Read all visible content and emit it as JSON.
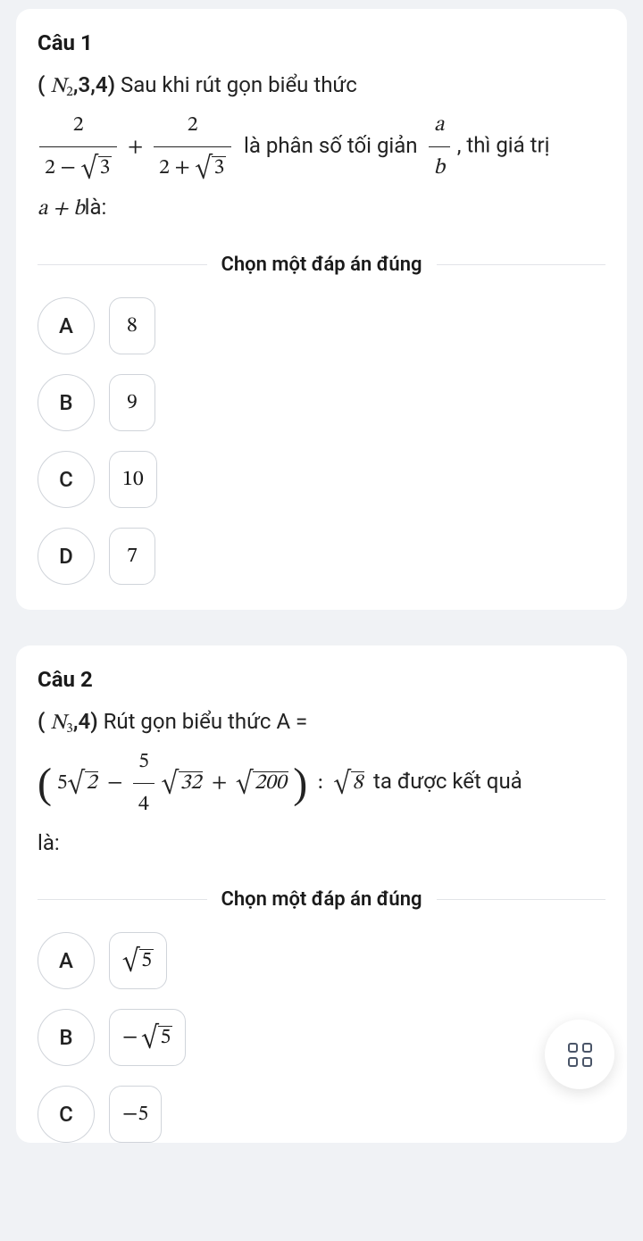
{
  "q1": {
    "title": "Câu 1",
    "tag_prefix": "N",
    "tag_sub": "2",
    "tag_suffix": ",3,4",
    "text_before_expr": "Sau khi rút gọn biểu thức",
    "frac1_num": "2",
    "frac1_den_left": "2 −",
    "frac1_den_rad": "3",
    "plus": "+",
    "frac2_num": "2",
    "frac2_den_left": "2 +",
    "frac2_den_rad": "3",
    "text_mid": "là phân số tối giản",
    "ab_num": "a",
    "ab_den": "b",
    "text_after": ", thì giá trị",
    "line2_left": "a + b",
    "line2_right": "là:",
    "instruction": "Chọn một đáp án đúng",
    "options": [
      {
        "letter": "A",
        "value": "8"
      },
      {
        "letter": "B",
        "value": "9"
      },
      {
        "letter": "C",
        "value": "10"
      },
      {
        "letter": "D",
        "value": "7"
      }
    ]
  },
  "q2": {
    "title": "Câu 2",
    "tag_prefix": "N",
    "tag_sub": "3",
    "tag_suffix": ",4",
    "text_before_expr": "Rút gọn biểu thức A =",
    "term1_coef": "5",
    "term1_rad": "2",
    "minus": "−",
    "frac_num": "5",
    "frac_den": "4",
    "term2_rad": "32",
    "plus": "+",
    "term3_rad": "200",
    "colon": ":",
    "div_rad": "8",
    "text_after": "ta được kết quả",
    "line2": "là:",
    "instruction": "Chọn một đáp án đúng",
    "options": [
      {
        "letter": "A",
        "value_type": "sqrt",
        "rad": "5"
      },
      {
        "letter": "B",
        "value_type": "negsqrt",
        "neg": "−",
        "rad": "5"
      },
      {
        "letter": "C",
        "value_type": "plain",
        "value": "−5"
      }
    ]
  }
}
